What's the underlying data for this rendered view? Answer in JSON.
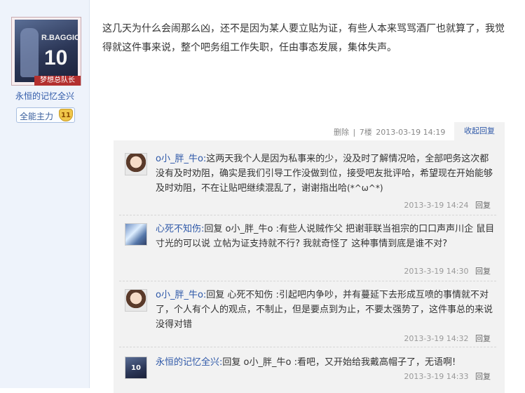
{
  "sidebar": {
    "avatar_jersey_name": "R.BAGGIO",
    "avatar_jersey_number": "10",
    "avatar_badge": "梦想总队长",
    "username": "永恒的记忆全兴",
    "level_title": "全能主力",
    "level_number": "11"
  },
  "post": {
    "text": "这几天为什么会闹那么凶，还不是因为某人要立贴为证，有些人本来骂骂酒厂也就算了，我觉得就这件事来说，整个吧务组工作失职，任由事态发展，集体失声。",
    "delete_label": "删除",
    "floor": "7楼",
    "timestamp": "2013-03-19 14:19",
    "collapse_label": "收起回复"
  },
  "comments": [
    {
      "user": "o小_胖_牛o:",
      "text": "这两天我个人是因为私事来的少，没及时了解情况哈，全部吧务这次都没有及时劝阻，确实是我们引导工作没做到位，接受吧友批评哈，希望现在开始能够及时劝阻，不在让贴吧继续混乱了，谢谢指出哈",
      "emoji": "(*^ω^*)",
      "time": "2013-3-19 14:24",
      "reply_label": "回复"
    },
    {
      "user": "心死不知伤:",
      "text": "回复 o小_胖_牛o :有些人说贼作父 把谢菲联当祖宗的口口声声川企 鼠目寸光的可以说 立帖为证支持就不行? 我就奇怪了 这种事情到底是谁不对?",
      "time": "2013-3-19 14:30",
      "reply_label": "回复"
    },
    {
      "user": "o小_胖_牛o:",
      "text": "回复 心死不知伤 :引起吧内争吵，并有蔓延下去形成互喷的事情就不对了，个人有个人的观点，不制止，但是要点到为止，不要太强势了，这件事总的来说没得对错",
      "time": "2013-3-19 14:32",
      "reply_label": "回复"
    },
    {
      "user": "永恒的记忆全兴:",
      "text": "回复 o小_胖_牛o :看吧，又开始给我戴高帽子了，无语啊!",
      "time": "2013-3-19 14:33",
      "reply_label": "回复"
    }
  ]
}
